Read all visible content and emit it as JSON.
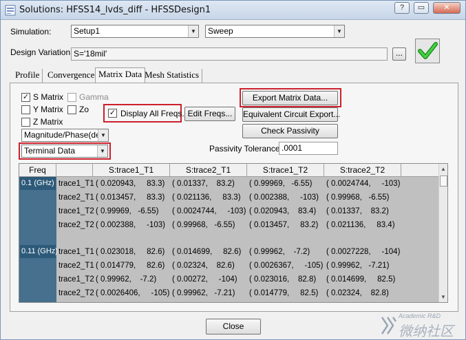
{
  "window": {
    "title": "Solutions: HFSS14_lvds_diff - HFSSDesign1",
    "controls": [
      "?",
      "▭",
      "✕"
    ]
  },
  "simulation": {
    "label": "Simulation:",
    "setup_value": "Setup1",
    "sweep_value": "Sweep"
  },
  "design_variation": {
    "label": "Design Variation:",
    "value": "S='18mil'",
    "browse_label": "..."
  },
  "tabs": [
    {
      "label": "Profile",
      "active": false
    },
    {
      "label": "Convergence",
      "active": false
    },
    {
      "label": "Matrix Data",
      "active": true
    },
    {
      "label": "Mesh Statistics",
      "active": false
    }
  ],
  "matrix_options": {
    "s_matrix": {
      "label": "S Matrix",
      "checked": true
    },
    "gamma": {
      "label": "Gamma",
      "checked": false
    },
    "y_matrix": {
      "label": "Y Matrix",
      "checked": false
    },
    "zo": {
      "label": "Zo",
      "checked": false
    },
    "z_matrix": {
      "label": "Z Matrix",
      "checked": false
    },
    "format_value": "Magnitude/Phase(deg",
    "data_type_value": "Terminal Data"
  },
  "display_all_freqs": {
    "label": "Display All Freqs.",
    "checked": true
  },
  "buttons": {
    "edit_freqs": "Edit Freqs...",
    "export_matrix": "Export Matrix Data...",
    "equivalent_circuit": "Equivalent Circuit Export...",
    "check_passivity": "Check Passivity",
    "close": "Close"
  },
  "passivity": {
    "label": "Passivity Tolerance:",
    "value": ".0001"
  },
  "table": {
    "headers": [
      "Freq",
      "",
      "S:trace1_T1",
      "S:trace2_T1",
      "S:trace1_T2",
      "S:trace2_T2"
    ],
    "groups": [
      {
        "freq": "0.1 (GHz)",
        "rows": [
          {
            "name": "trace1_T1",
            "cells": [
              "( 0.020943,     83.3)",
              "( 0.01337,    83.2)",
              "( 0.99969,   -6.55)",
              "( 0.0024744,     -103)"
            ]
          },
          {
            "name": "trace2_T1",
            "cells": [
              "( 0.013457,     83.3)",
              "( 0.021136,     83.3)",
              "( 0.002388,     -103)",
              "( 0.99968,   -6.55)"
            ]
          },
          {
            "name": "trace1_T2",
            "cells": [
              "( 0.99969,   -6.55)",
              "( 0.0024744,     -103)",
              "( 0.020943,    83.4)",
              "( 0.01337,    83.2)"
            ]
          },
          {
            "name": "trace2_T2",
            "cells": [
              "( 0.002388,     -103)",
              "( 0.99968,   -6.55)",
              "( 0.013457,     83.2)",
              "( 0.021136,     83.4)"
            ]
          }
        ]
      },
      {
        "freq": "0.11 (GHz)",
        "rows": [
          {
            "name": "trace1_T1",
            "cells": [
              "( 0.023018,     82.6)",
              "( 0.014699,     82.6)",
              "( 0.99962,    -7.2)",
              "( 0.0027228,     -104)"
            ]
          },
          {
            "name": "trace2_T1",
            "cells": [
              "( 0.014779,     82.6)",
              "( 0.02324,    82.6)",
              "( 0.0026367,     -105)",
              "( 0.99962,   -7.21)"
            ]
          },
          {
            "name": "trace1_T2",
            "cells": [
              "( 0.99962,    -7.2)",
              "( 0.00272,     -104)",
              "( 0.023016,    82.8)",
              "( 0.014699,     82.5)"
            ]
          },
          {
            "name": "trace2_T2",
            "cells": [
              "( 0.0026406,     -105)",
              "( 0.99962,   -7.21)",
              "( 0.014779,     82.5)",
              "( 0.02324,    82.8)"
            ]
          }
        ]
      }
    ]
  },
  "watermark": {
    "line1": "Academic R&D",
    "line2": "微纳社区"
  },
  "colors": {
    "highlight_red": "#cc1f2b",
    "freq_column": "#46708d",
    "grid_body": "#c0c0c0",
    "check_green": "#2eb82e"
  }
}
